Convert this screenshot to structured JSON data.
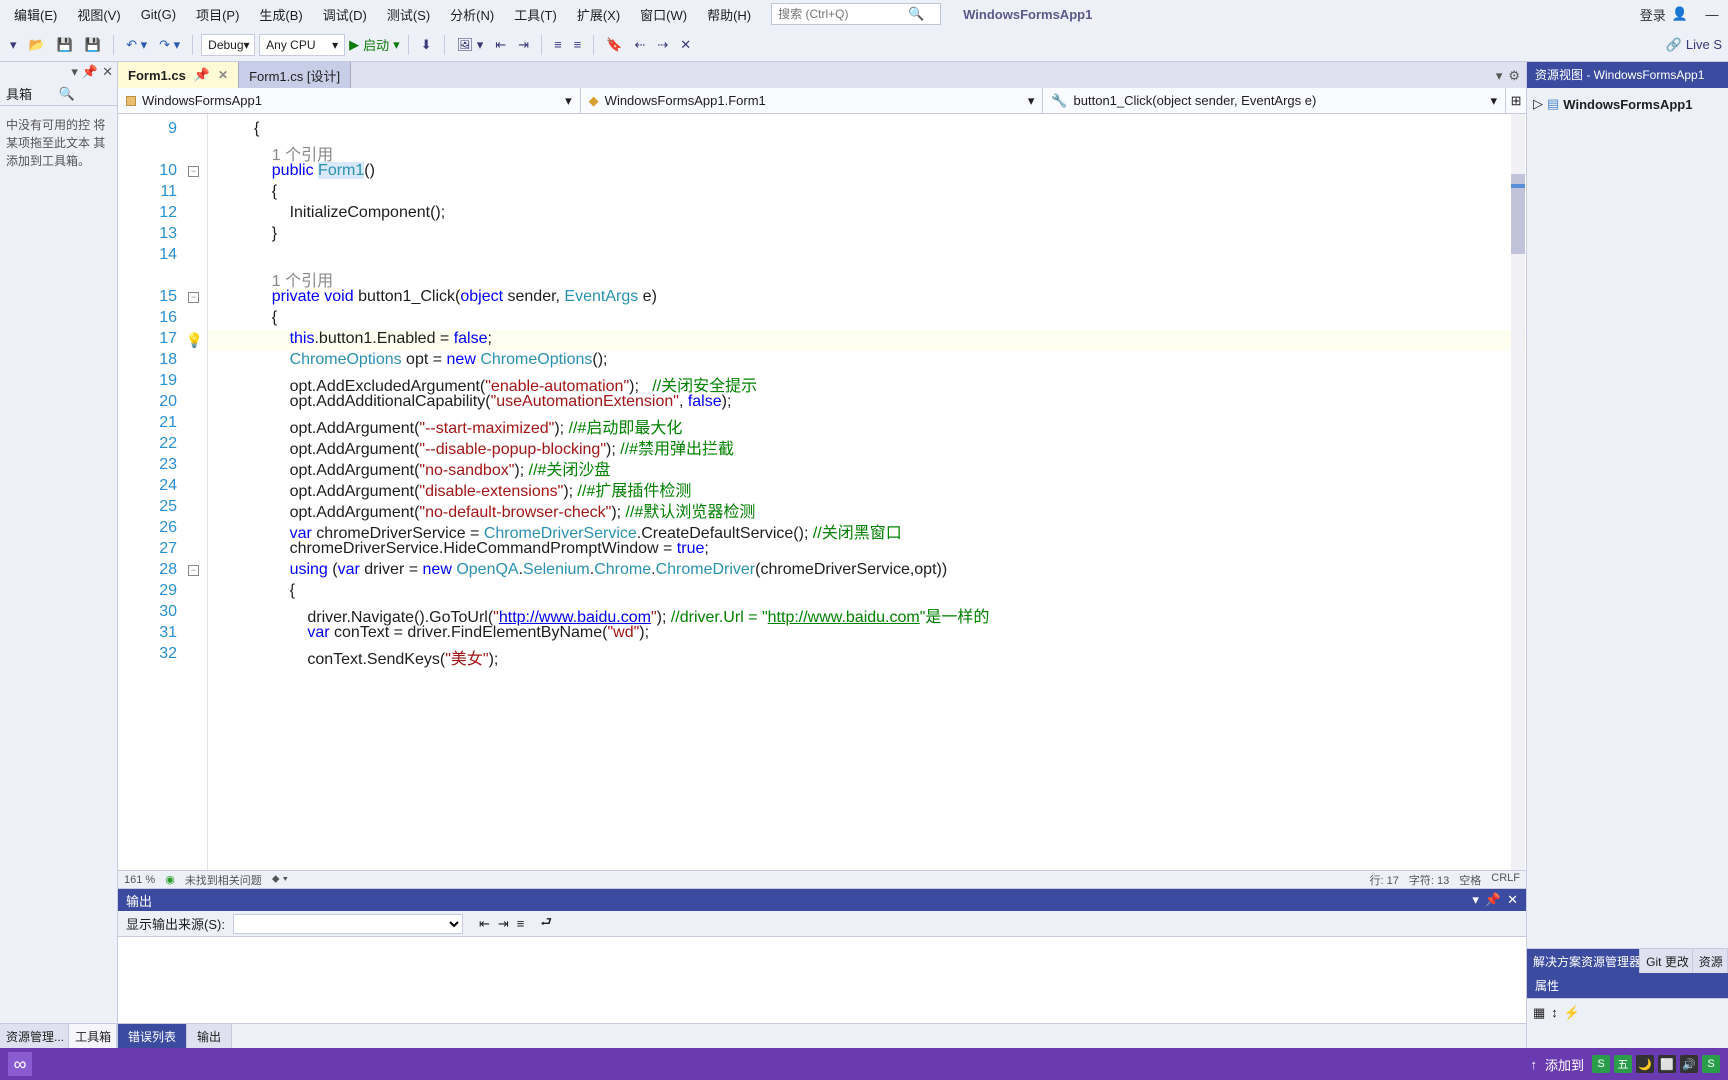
{
  "menus": [
    "编辑(E)",
    "视图(V)",
    "Git(G)",
    "项目(P)",
    "生成(B)",
    "调试(D)",
    "测试(S)",
    "分析(N)",
    "工具(T)",
    "扩展(X)",
    "窗口(W)",
    "帮助(H)"
  ],
  "search_placeholder": "搜索 (Ctrl+Q)",
  "app_name": "WindowsFormsApp1",
  "login": "登录",
  "config": "Debug",
  "platform": "Any CPU",
  "launch": "启动",
  "liveshare": "Live S",
  "toolbox": {
    "title": "具箱",
    "msg": "中没有可用的控\n将某项拖至此文本\n其添加到工具箱。"
  },
  "left_tabs": [
    "资源管理...",
    "工具箱"
  ],
  "tabs": [
    {
      "label": "Form1.cs",
      "active": true,
      "close": true
    },
    {
      "label": "Form1.cs [设计]",
      "active": false,
      "close": false
    }
  ],
  "nav": {
    "project": "WindowsFormsApp1",
    "class": "WindowsFormsApp1.Form1",
    "member": "button1_Click(object sender, EventArgs e)"
  },
  "lines_start": 9,
  "ref1": "1 个引用",
  "ref2": "1 个引用",
  "status": {
    "zoom": "161 %",
    "issues": "未找到相关问题",
    "ln": "行: 17",
    "col": "字符: 13",
    "space": "空格",
    "crlf": "CRLF"
  },
  "output": {
    "title": "输出",
    "src_label": "显示输出来源(S):"
  },
  "bot_tabs": [
    "错误列表",
    "输出"
  ],
  "right": {
    "title": "资源视图 - WindowsFormsApp1",
    "tree_item": "WindowsFormsApp1",
    "tabs": [
      "解决方案资源管理器",
      "Git 更改",
      "资源"
    ],
    "props": "属性"
  },
  "addto": "添加到",
  "chart_data": null
}
